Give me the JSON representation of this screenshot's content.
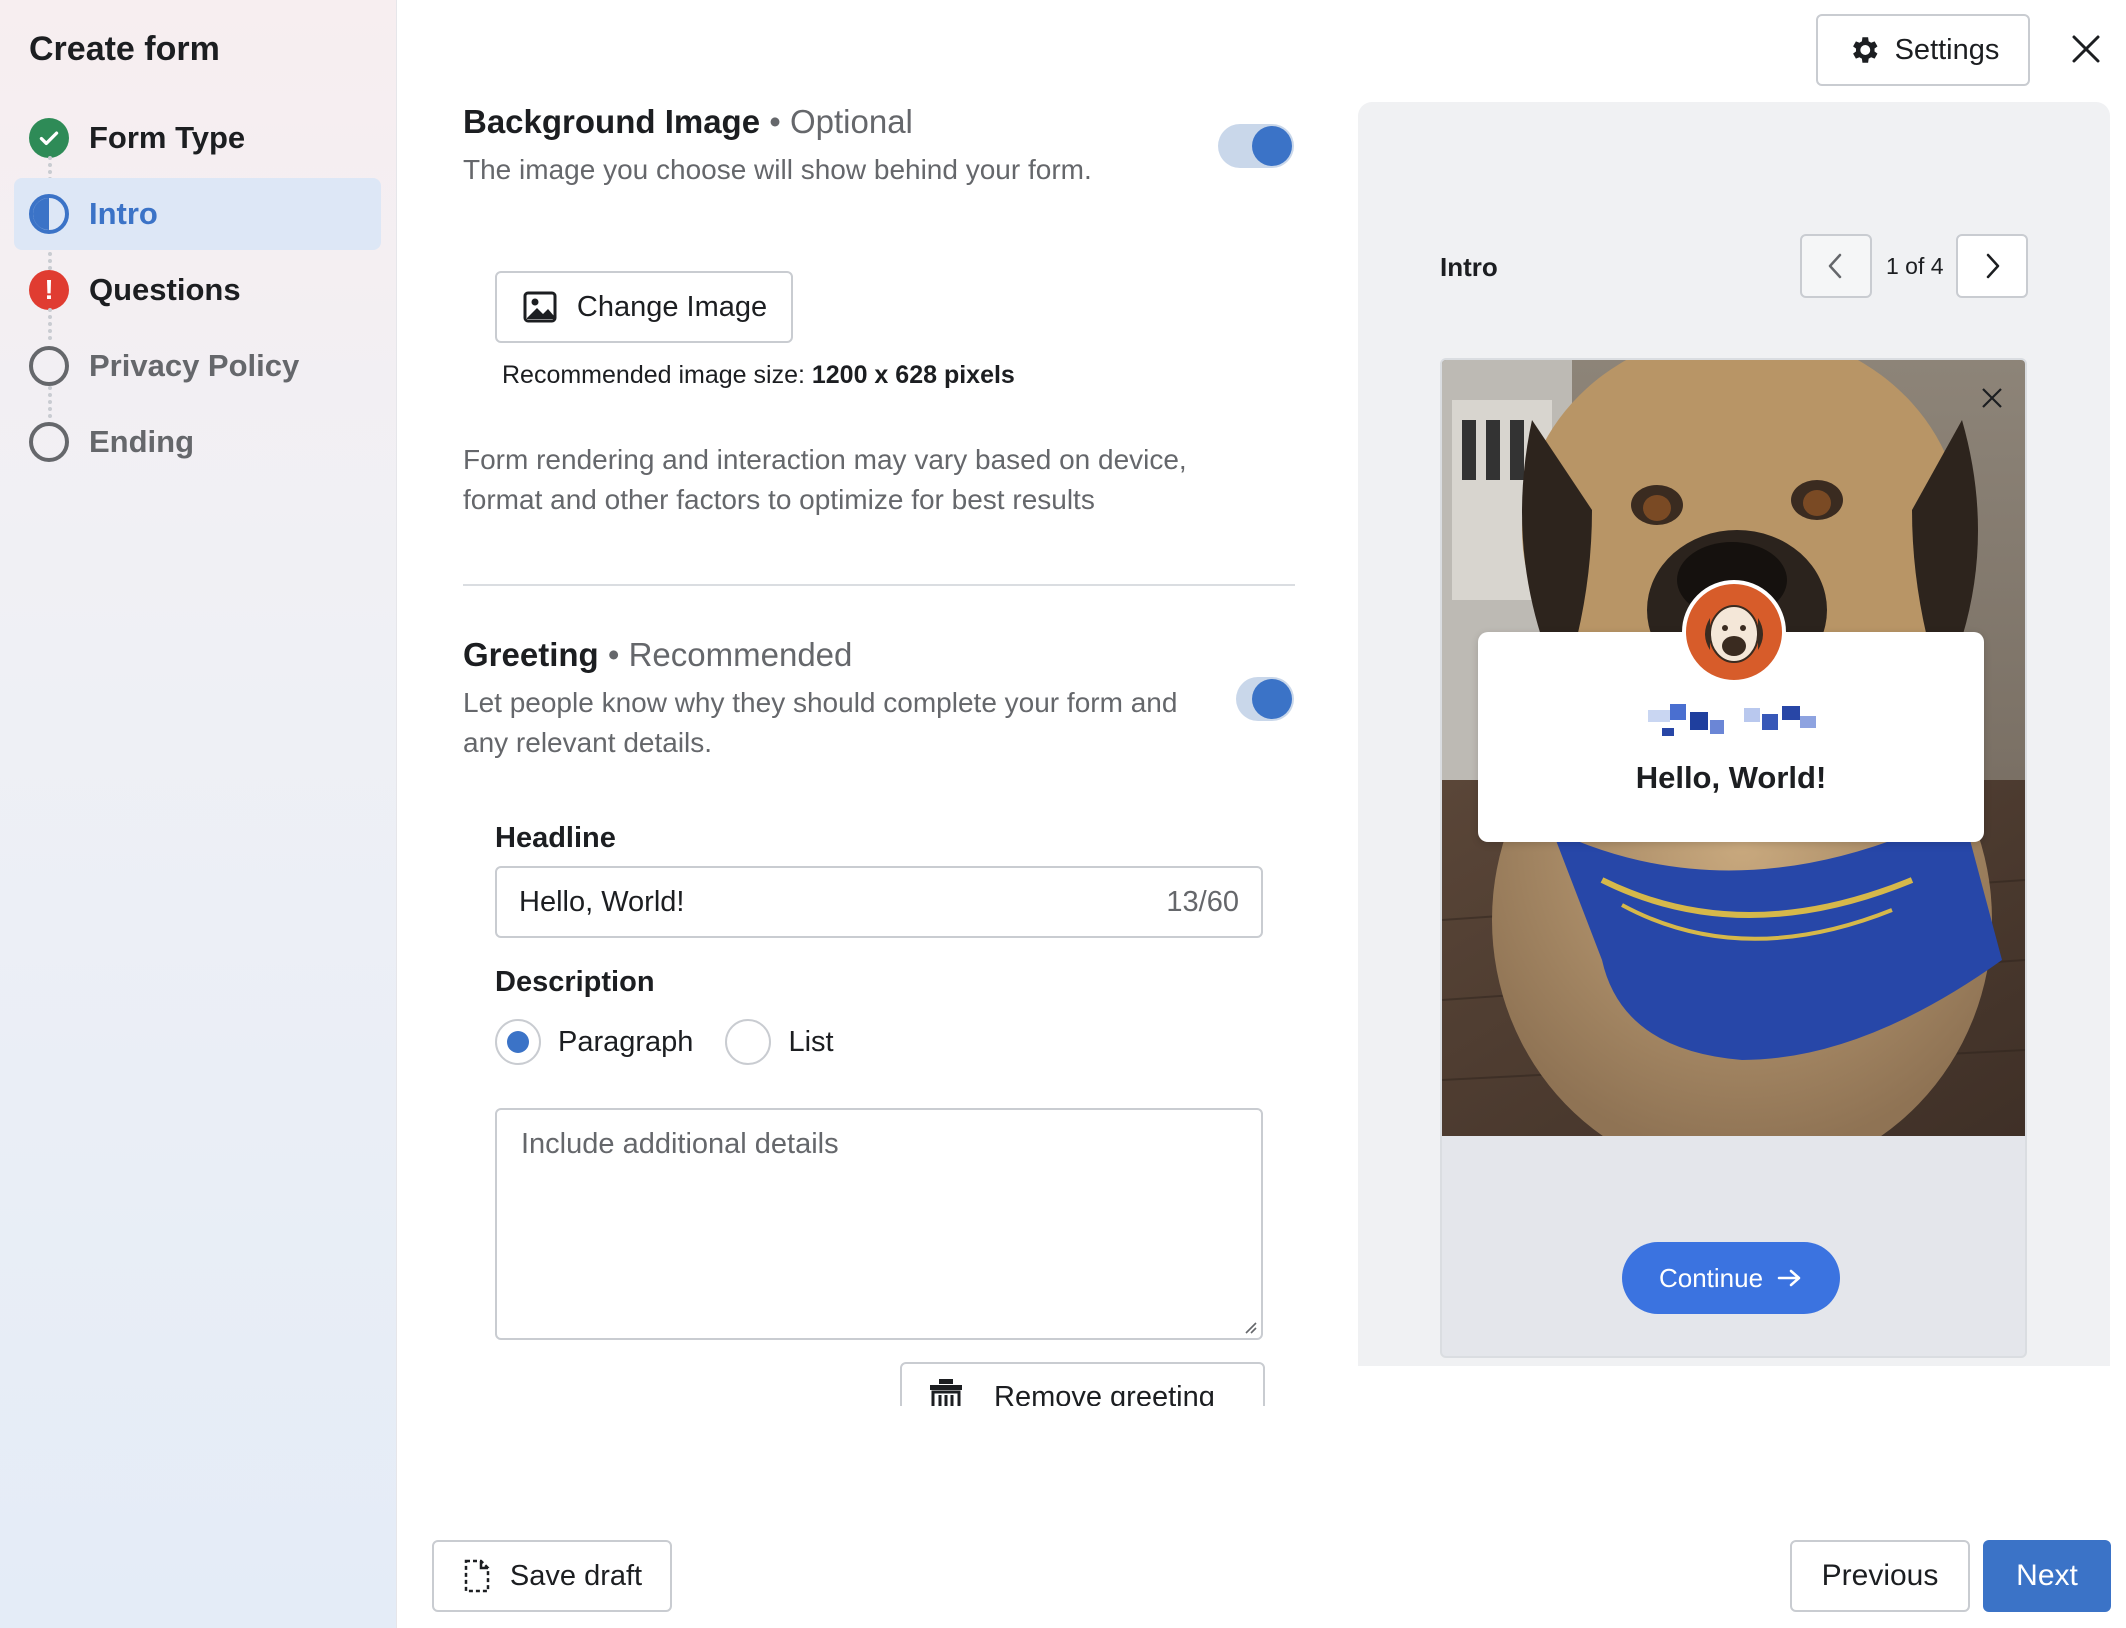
{
  "sidebar": {
    "title": "Create form",
    "steps": [
      {
        "label": "Form Type",
        "status": "complete"
      },
      {
        "label": "Intro",
        "status": "in-progress"
      },
      {
        "label": "Questions",
        "status": "error"
      },
      {
        "label": "Privacy Policy",
        "status": "not-started"
      },
      {
        "label": "Ending",
        "status": "not-started"
      }
    ]
  },
  "header": {
    "settings_label": "Settings"
  },
  "background_image": {
    "title": "Background Image",
    "tag": "• Optional",
    "description": "The image you choose will show behind your form.",
    "enabled": true,
    "change_button": "Change Image",
    "recommended_prefix": "Recommended image size: ",
    "recommended_value": "1200 x 628 pixels",
    "notice_line1": "Form rendering and interaction may vary based on device,",
    "notice_line2": "format and other factors to optimize for best results"
  },
  "greeting": {
    "title": "Greeting",
    "tag": "• Recommended",
    "description_line1": "Let people know why they should complete your form and",
    "description_line2": "any relevant details.",
    "enabled": true,
    "headline_label": "Headline",
    "headline_value": "Hello, World!",
    "headline_count": "13/60",
    "description_label": "Description",
    "description_options": [
      "Paragraph",
      "List"
    ],
    "description_selected": "Paragraph",
    "details_placeholder": "Include additional details",
    "remove_button": "Remove greeting"
  },
  "preview": {
    "title": "Intro",
    "pager": "1 of 4",
    "card_headline": "Hello, World!",
    "continue_label": "Continue"
  },
  "footer": {
    "save_draft": "Save draft",
    "previous": "Previous",
    "next": "Next"
  },
  "colors": {
    "accent": "#3b73c7",
    "success": "#2e8b57",
    "error": "#e03c31",
    "preview_button": "#3b73e0"
  },
  "icons": [
    "check-icon",
    "half-circle-icon",
    "error-icon",
    "empty-circle-icon",
    "gear-icon",
    "close-icon",
    "image-icon",
    "trash-icon",
    "chevron-left-icon",
    "chevron-right-icon",
    "arrow-right-icon",
    "document-icon"
  ]
}
